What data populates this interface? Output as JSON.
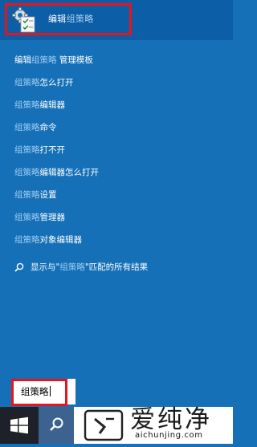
{
  "top_result": {
    "label_part1": "编辑",
    "label_part2": "组策略",
    "icon": "group-policy-editor-icon"
  },
  "results": [
    {
      "a": "编辑",
      "b": "组策略",
      "c": " 管理模板"
    },
    {
      "a": "",
      "b": "组策略",
      "c": "怎么打开"
    },
    {
      "a": "",
      "b": "组策略",
      "c": "编辑器"
    },
    {
      "a": "",
      "b": "组策略",
      "c": "命令"
    },
    {
      "a": "",
      "b": "组策略",
      "c": "打不开"
    },
    {
      "a": "",
      "b": "组策略",
      "c": "编辑器怎么打开"
    },
    {
      "a": "",
      "b": "组策略",
      "c": "设置"
    },
    {
      "a": "",
      "b": "组策略",
      "c": "管理器"
    },
    {
      "a": "",
      "b": "组策略",
      "c": "对象编辑器"
    }
  ],
  "web_search": {
    "pre": "显示与\"",
    "term": "组策略",
    "post": "\"匹配的所有结果",
    "icon": "search-icon"
  },
  "search_box": {
    "value": "组策略"
  },
  "taskbar": {
    "start_icon": "windows-logo-icon",
    "search_icon": "search-icon"
  },
  "watermark": {
    "text": "爱纯净",
    "url": "aichunjing.com"
  },
  "colors": {
    "panel": "#1570b8",
    "top_result_bg": "#0c5ea6",
    "highlight_box": "#e8141c",
    "taskbar": "#1e2129",
    "taskbar_search": "#3c6390"
  }
}
